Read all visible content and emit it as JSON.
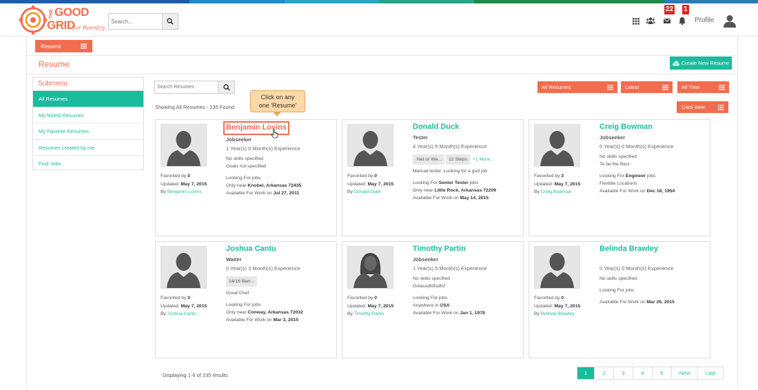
{
  "brand": {
    "logo_line1": "THE",
    "logo_line2": "GOOD",
    "logo_line3": "GRID",
    "logo_tag": "for Reentry",
    "colors": {
      "accent": "#f26c4f",
      "teal": "#1abc9c",
      "badge": "#e02424"
    }
  },
  "header": {
    "search_placeholder": "Search...",
    "search_icon": "search-icon",
    "icons": [
      "apps-grid-icon",
      "users-icon",
      "mail-icon",
      "bell-icon"
    ],
    "mail_badge": "22",
    "notification_badge": "1",
    "profile_label": "Profile"
  },
  "nav": {
    "resume_tab": "Resume"
  },
  "page": {
    "title": "Resume",
    "create_button": "Create New Resume"
  },
  "submenu": {
    "title": "Submenu",
    "items": [
      "All Resumes",
      "My Noted Resumes",
      "My Favorite Resumes",
      "Resumes created by me",
      "Find Jobs"
    ]
  },
  "toolbar": {
    "search_placeholder": "Search Resumes",
    "filter_all": "All Resumes",
    "filter_latest": "Latest",
    "filter_time": "All Time",
    "showing": "Showing All Resumes - 235 Found",
    "card_view": "Card View"
  },
  "callout": {
    "line1": "Click on any",
    "line2": "one 'Resume'"
  },
  "cards": [
    {
      "name": "Benjamin Lovins",
      "role": "Jobseeker",
      "experience": "1 Year(s) 0 Month(s) Experience",
      "skills_text": "No skills specified",
      "goals": "Goals not specified",
      "looking_label": "Looking For jobs",
      "only_near_label": "Only near",
      "location": "Knobel, Arkansas 72435",
      "available_label": "Available For Work on",
      "available_date": "Jul 27, 2011",
      "favorited_label": "Favorited by",
      "favorited": "0",
      "updated_label": "Updated:",
      "updated": "May 7, 2015",
      "by_label": "By",
      "by": "Benjamin Lovins"
    },
    {
      "name": "Donald Duck",
      "role": "Tester",
      "experience": "4 Year(s) 5 Month(s) Experience",
      "chips": [
        ".Net or We...",
        "12 Steps"
      ],
      "more": "+1 More...",
      "goals": "Manual tester. Looking for a gud job",
      "looking_label": "Looking For",
      "looking_for": "Senior Tester",
      "looking_suffix": "jobs",
      "only_near_label": "Only near",
      "location": "Little Rock, Arkansas 72209",
      "available_label": "Available For Work on",
      "available_date": "May 14, 2015",
      "favorited_label": "Favorited by",
      "favorited": "0",
      "updated_label": "Updated:",
      "updated": "May 7, 2015",
      "by_label": "By",
      "by": "Donald Duck"
    },
    {
      "name": "Creig Bowman",
      "role": "Jobseeker",
      "experience": "0 Year(s) 0 Month(s) Experience",
      "skills_text": "No skills specified",
      "goals": "To be the Best",
      "looking_label": "Looking For",
      "looking_for": "Engineer",
      "looking_suffix": "jobs",
      "location_text": "Flexible Locations",
      "available_label": "Available For Work on",
      "available_date": "Dec 18, 1954",
      "favorited_label": "Favorited by",
      "favorited": "3",
      "updated_label": "Updated:",
      "updated": "May 7, 2015",
      "by_label": "By",
      "by": "Creig Bowman"
    },
    {
      "name": "Joshua Cantu",
      "role": "Waiter",
      "experience": "0 Year(s) 3 Month(s) Experience",
      "chips": [
        "14/16 Barr..."
      ],
      "goals": "Great Chef",
      "looking_label": "Looking For jobs",
      "only_near_label": "Only near",
      "location": "Conway, Arkansas 72032",
      "available_label": "Available For Work on",
      "available_date": "Mar 3, 2015",
      "favorited_label": "Favorited by",
      "favorited": "0",
      "updated_label": "Updated:",
      "updated": "May 7, 2015",
      "by_label": "By",
      "by": "Joshua Cantu"
    },
    {
      "name": "Timothy Partin",
      "role": "Jobseeker",
      "experience": "1 Year(s) 5 Month(s) Experience",
      "skills_text": "No skills specified",
      "goals": "Golassdfdfsdfsf",
      "looking_label": "Looking For jobs",
      "anywhere_label": "Anywhere in",
      "location": "USA",
      "available_label": "Available For Work on",
      "available_date": "Jan 1, 1979",
      "favorited_label": "Favorited by",
      "favorited": "0",
      "updated_label": "Updated:",
      "updated": "May 7, 2015",
      "by_label": "By",
      "by": "Timothy Partin"
    },
    {
      "name": "Belinda Brawley",
      "role": "",
      "experience": "0 Year(s) 0 Month(s) Experience",
      "skills_text": "No skills specified",
      "looking_label": "Looking For jobs",
      "available_label": "Available For Work on",
      "available_date": "Mar 26, 2015",
      "favorited_label": "Favorited by",
      "favorited": "0",
      "updated_label": "Updated:",
      "updated": "May 7, 2015",
      "by_label": "By",
      "by": "Belinda Brawley"
    }
  ],
  "footer": {
    "displaying": "Displaying 1-6 of 235 results",
    "pages": [
      "1",
      "2",
      "3",
      "4",
      "5",
      "Next",
      "Last"
    ]
  }
}
